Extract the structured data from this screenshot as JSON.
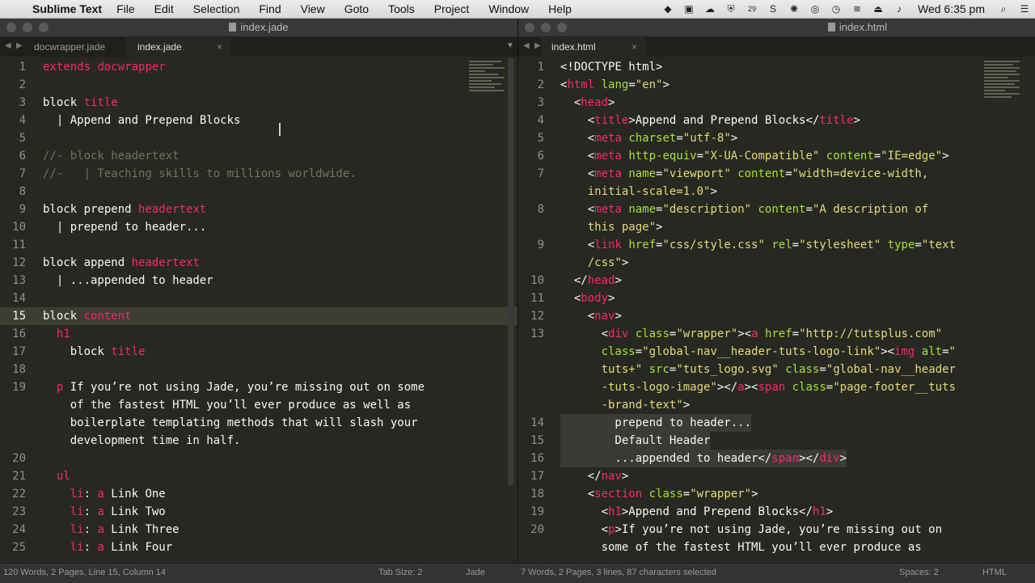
{
  "menubar": {
    "app": "Sublime Text",
    "items": [
      "File",
      "Edit",
      "Selection",
      "Find",
      "View",
      "Goto",
      "Tools",
      "Project",
      "Window",
      "Help"
    ],
    "tray_icons": [
      "dropbox-icon",
      "book-icon",
      "cloud-icon",
      "shield-icon",
      "calendar-icon",
      "skype-icon",
      "flux-icon",
      "chrome-icon",
      "timemachine-icon",
      "wifi-icon",
      "eject-icon",
      "volume-icon"
    ],
    "calendar_badge": "29",
    "clock": "Wed 6:35 pm"
  },
  "left": {
    "window_title": "index.jade",
    "tabs": [
      {
        "label": "docwrapper.jade"
      },
      {
        "label": "index.jade"
      }
    ],
    "lines": [
      {
        "n": "1",
        "t": [
          [
            "r",
            "extends"
          ],
          [
            "k",
            " "
          ],
          [
            "r",
            "docwrapper"
          ]
        ]
      },
      {
        "n": "2",
        "t": []
      },
      {
        "n": "3",
        "t": [
          [
            "k",
            "block "
          ],
          [
            "r",
            "title"
          ]
        ]
      },
      {
        "n": "4",
        "t": [
          [
            "k",
            "  | Append and Prepend Blocks"
          ]
        ]
      },
      {
        "n": "5",
        "t": []
      },
      {
        "n": "6",
        "t": [
          [
            "c",
            "//- block headertext"
          ]
        ]
      },
      {
        "n": "7",
        "t": [
          [
            "c",
            "//-   | Teaching skills to millions worldwide."
          ]
        ]
      },
      {
        "n": "8",
        "t": []
      },
      {
        "n": "9",
        "t": [
          [
            "k",
            "block prepend "
          ],
          [
            "r",
            "headertext"
          ]
        ]
      },
      {
        "n": "10",
        "t": [
          [
            "k",
            "  | prepend to header..."
          ]
        ]
      },
      {
        "n": "11",
        "t": []
      },
      {
        "n": "12",
        "t": [
          [
            "k",
            "block append "
          ],
          [
            "r",
            "headertext"
          ]
        ]
      },
      {
        "n": "13",
        "t": [
          [
            "k",
            "  | ...appended to header"
          ]
        ]
      },
      {
        "n": "14",
        "t": []
      },
      {
        "n": "15",
        "t": [
          [
            "k",
            "block "
          ],
          [
            "r",
            "content"
          ]
        ],
        "current": true
      },
      {
        "n": "16",
        "t": [
          [
            "r",
            "  h1"
          ]
        ]
      },
      {
        "n": "17",
        "t": [
          [
            "k",
            "    block "
          ],
          [
            "r",
            "title"
          ]
        ]
      },
      {
        "n": "18",
        "t": []
      },
      {
        "n": "19",
        "t": [
          [
            "r",
            "  p"
          ],
          [
            "k",
            " If you’re not using Jade, you’re missing out on some"
          ]
        ]
      },
      {
        "n": "",
        "t": [
          [
            "k",
            "    of the fastest HTML you’ll ever produce as well as"
          ]
        ]
      },
      {
        "n": "",
        "t": [
          [
            "k",
            "    boilerplate templating methods that will slash your"
          ]
        ]
      },
      {
        "n": "",
        "t": [
          [
            "k",
            "    development time in half."
          ]
        ]
      },
      {
        "n": "20",
        "t": []
      },
      {
        "n": "21",
        "t": [
          [
            "r",
            "  ul"
          ]
        ]
      },
      {
        "n": "22",
        "t": [
          [
            "r",
            "    li"
          ],
          [
            "k",
            ": "
          ],
          [
            "r",
            "a"
          ],
          [
            "k",
            " Link One"
          ]
        ]
      },
      {
        "n": "23",
        "t": [
          [
            "r",
            "    li"
          ],
          [
            "k",
            ": "
          ],
          [
            "r",
            "a"
          ],
          [
            "k",
            " Link Two"
          ]
        ]
      },
      {
        "n": "24",
        "t": [
          [
            "r",
            "    li"
          ],
          [
            "k",
            ": "
          ],
          [
            "r",
            "a"
          ],
          [
            "k",
            " Link Three"
          ]
        ]
      },
      {
        "n": "25",
        "t": [
          [
            "r",
            "    li"
          ],
          [
            "k",
            ": "
          ],
          [
            "r",
            "a"
          ],
          [
            "k",
            " Link Four"
          ]
        ]
      }
    ]
  },
  "right": {
    "window_title": "index.html",
    "tabs": [
      {
        "label": "index.html"
      }
    ],
    "lines": [
      {
        "n": "1",
        "t": [
          [
            "k",
            "<!DOCTYPE html>"
          ]
        ]
      },
      {
        "n": "2",
        "t": [
          [
            "k",
            "<"
          ],
          [
            "r",
            "html"
          ],
          [
            "k",
            " "
          ],
          [
            "g",
            "lang"
          ],
          [
            "k",
            "="
          ],
          [
            "y",
            "\"en\""
          ],
          [
            "k",
            ">"
          ]
        ]
      },
      {
        "n": "3",
        "t": [
          [
            "k",
            "  <"
          ],
          [
            "r",
            "head"
          ],
          [
            "k",
            ">"
          ]
        ]
      },
      {
        "n": "4",
        "t": [
          [
            "k",
            "    <"
          ],
          [
            "r",
            "title"
          ],
          [
            "k",
            ">Append and Prepend Blocks</"
          ],
          [
            "r",
            "title"
          ],
          [
            "k",
            ">"
          ]
        ]
      },
      {
        "n": "5",
        "t": [
          [
            "k",
            "    <"
          ],
          [
            "r",
            "meta"
          ],
          [
            "k",
            " "
          ],
          [
            "g",
            "charset"
          ],
          [
            "k",
            "="
          ],
          [
            "y",
            "\"utf-8\""
          ],
          [
            "k",
            ">"
          ]
        ]
      },
      {
        "n": "6",
        "t": [
          [
            "k",
            "    <"
          ],
          [
            "r",
            "meta"
          ],
          [
            "k",
            " "
          ],
          [
            "g",
            "http-equiv"
          ],
          [
            "k",
            "="
          ],
          [
            "y",
            "\"X-UA-Compatible\""
          ],
          [
            "k",
            " "
          ],
          [
            "g",
            "content"
          ],
          [
            "k",
            "="
          ],
          [
            "y",
            "\"IE=edge\""
          ],
          [
            "k",
            ">"
          ]
        ]
      },
      {
        "n": "7",
        "t": [
          [
            "k",
            "    <"
          ],
          [
            "r",
            "meta"
          ],
          [
            "k",
            " "
          ],
          [
            "g",
            "name"
          ],
          [
            "k",
            "="
          ],
          [
            "y",
            "\"viewport\""
          ],
          [
            "k",
            " "
          ],
          [
            "g",
            "content"
          ],
          [
            "k",
            "="
          ],
          [
            "y",
            "\"width=device-width,"
          ]
        ]
      },
      {
        "n": "",
        "t": [
          [
            "y",
            "    initial-scale=1.0\""
          ],
          [
            "k",
            ">"
          ]
        ]
      },
      {
        "n": "8",
        "t": [
          [
            "k",
            "    <"
          ],
          [
            "r",
            "meta"
          ],
          [
            "k",
            " "
          ],
          [
            "g",
            "name"
          ],
          [
            "k",
            "="
          ],
          [
            "y",
            "\"description\""
          ],
          [
            "k",
            " "
          ],
          [
            "g",
            "content"
          ],
          [
            "k",
            "="
          ],
          [
            "y",
            "\"A description of"
          ]
        ]
      },
      {
        "n": "",
        "t": [
          [
            "y",
            "    this page\""
          ],
          [
            "k",
            ">"
          ]
        ]
      },
      {
        "n": "9",
        "t": [
          [
            "k",
            "    <"
          ],
          [
            "r",
            "link"
          ],
          [
            "k",
            " "
          ],
          [
            "g",
            "href"
          ],
          [
            "k",
            "="
          ],
          [
            "y",
            "\"css/style.css\""
          ],
          [
            "k",
            " "
          ],
          [
            "g",
            "rel"
          ],
          [
            "k",
            "="
          ],
          [
            "y",
            "\"stylesheet\""
          ],
          [
            "k",
            " "
          ],
          [
            "g",
            "type"
          ],
          [
            "k",
            "="
          ],
          [
            "y",
            "\"text"
          ]
        ]
      },
      {
        "n": "",
        "t": [
          [
            "y",
            "    /css\""
          ],
          [
            "k",
            ">"
          ]
        ]
      },
      {
        "n": "10",
        "t": [
          [
            "k",
            "  </"
          ],
          [
            "r",
            "head"
          ],
          [
            "k",
            ">"
          ]
        ]
      },
      {
        "n": "11",
        "t": [
          [
            "k",
            "  <"
          ],
          [
            "r",
            "body"
          ],
          [
            "k",
            ">"
          ]
        ]
      },
      {
        "n": "12",
        "t": [
          [
            "k",
            "    <"
          ],
          [
            "r",
            "nav"
          ],
          [
            "k",
            ">"
          ]
        ]
      },
      {
        "n": "13",
        "t": [
          [
            "k",
            "      <"
          ],
          [
            "r",
            "div"
          ],
          [
            "k",
            " "
          ],
          [
            "g",
            "class"
          ],
          [
            "k",
            "="
          ],
          [
            "y",
            "\"wrapper\""
          ],
          [
            "k",
            "><"
          ],
          [
            "r",
            "a"
          ],
          [
            "k",
            " "
          ],
          [
            "g",
            "href"
          ],
          [
            "k",
            "="
          ],
          [
            "y",
            "\"http://tutsplus.com\""
          ]
        ]
      },
      {
        "n": "",
        "t": [
          [
            "k",
            "      "
          ],
          [
            "g",
            "class"
          ],
          [
            "k",
            "="
          ],
          [
            "y",
            "\"global-nav__header-tuts-logo-link\""
          ],
          [
            "k",
            "><"
          ],
          [
            "r",
            "img"
          ],
          [
            "k",
            " "
          ],
          [
            "g",
            "alt"
          ],
          [
            "k",
            "="
          ],
          [
            "y",
            "\""
          ]
        ]
      },
      {
        "n": "",
        "t": [
          [
            "y",
            "      tuts+\""
          ],
          [
            "k",
            " "
          ],
          [
            "g",
            "src"
          ],
          [
            "k",
            "="
          ],
          [
            "y",
            "\"tuts_logo.svg\""
          ],
          [
            "k",
            " "
          ],
          [
            "g",
            "class"
          ],
          [
            "k",
            "="
          ],
          [
            "y",
            "\"global-nav__header"
          ]
        ]
      },
      {
        "n": "",
        "t": [
          [
            "y",
            "      -tuts-logo-image\""
          ],
          [
            "k",
            "></"
          ],
          [
            "r",
            "a"
          ],
          [
            "k",
            "><"
          ],
          [
            "r",
            "span"
          ],
          [
            "k",
            " "
          ],
          [
            "g",
            "class"
          ],
          [
            "k",
            "="
          ],
          [
            "y",
            "\"page-footer__tuts"
          ]
        ]
      },
      {
        "n": "",
        "t": [
          [
            "y",
            "      -brand-text\""
          ],
          [
            "k",
            ">"
          ]
        ]
      },
      {
        "n": "14",
        "t": [
          [
            "k",
            "        prepend to header..."
          ]
        ],
        "sel": true
      },
      {
        "n": "15",
        "t": [
          [
            "k",
            "        Default Header"
          ]
        ],
        "sel": true
      },
      {
        "n": "16",
        "t": [
          [
            "k",
            "        ...appended to header</"
          ],
          [
            "r",
            "span"
          ],
          [
            "k",
            "></"
          ],
          [
            "r",
            "div"
          ],
          [
            "k",
            ">"
          ]
        ],
        "sel": true
      },
      {
        "n": "17",
        "t": [
          [
            "k",
            "    </"
          ],
          [
            "r",
            "nav"
          ],
          [
            "k",
            ">"
          ]
        ]
      },
      {
        "n": "18",
        "t": [
          [
            "k",
            "    <"
          ],
          [
            "r",
            "section"
          ],
          [
            "k",
            " "
          ],
          [
            "g",
            "class"
          ],
          [
            "k",
            "="
          ],
          [
            "y",
            "\"wrapper\""
          ],
          [
            "k",
            ">"
          ]
        ]
      },
      {
        "n": "19",
        "t": [
          [
            "k",
            "      <"
          ],
          [
            "r",
            "h1"
          ],
          [
            "k",
            ">Append and Prepend Blocks</"
          ],
          [
            "r",
            "h1"
          ],
          [
            "k",
            ">"
          ]
        ]
      },
      {
        "n": "20",
        "t": [
          [
            "k",
            "      <"
          ],
          [
            "r",
            "p"
          ],
          [
            "k",
            ">If you’re not using Jade, you’re missing out on"
          ]
        ]
      },
      {
        "n": "",
        "t": [
          [
            "k",
            "      some of the fastest HTML you’ll ever produce as"
          ]
        ]
      }
    ]
  },
  "status": {
    "left_info": "120 Words, 2 Pages, Line 15, Column 14",
    "left_tab_size": "Tab Size: 2",
    "left_syntax": "Jade",
    "right_info": "7 Words, 2 Pages, 3 lines, 87 characters selected",
    "right_spaces": "Spaces: 2",
    "right_syntax": "HTML"
  }
}
